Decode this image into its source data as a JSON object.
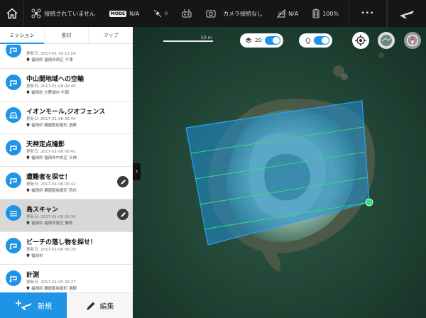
{
  "topbar": {
    "connection_status": "接続されていません",
    "mode_badge": "MODE",
    "mode_value": "N/A",
    "satellite_count": "0",
    "camera_status": "カメラ接続なし",
    "signal_value": "N/A",
    "battery": "100%",
    "more_label": "•••"
  },
  "tabs": [
    {
      "label": "ミッション",
      "active": true
    },
    {
      "label": "素材",
      "active": false
    },
    {
      "label": "マップ",
      "active": false
    }
  ],
  "missions": [
    {
      "title": "",
      "date": "更新日: 2017-01-10 12:04",
      "location": "福岡県 福岡市西区 今津",
      "selected": false,
      "action": false
    },
    {
      "title": "中山間地域への空輸",
      "date": "更新日: 2017-01-08 00:49",
      "location": "福岡県 大野城市 牛頸",
      "selected": false,
      "action": false
    },
    {
      "title": "イオンモール,ジオフェンス",
      "date": "更新日: 2017-01-08 00:44",
      "location": "福岡県 糟屋郡粕屋町 酒殿",
      "selected": false,
      "action": false
    },
    {
      "title": "天神定点撮影",
      "date": "更新日: 2017-01-08 00:43",
      "location": "福岡県 福岡市中央区 天神",
      "selected": false,
      "action": false
    },
    {
      "title": "遭難者を探せ！",
      "date": "更新日: 2017-01-08 00:42",
      "location": "福岡県 糟屋郡粕屋町 若杉",
      "selected": false,
      "action": true
    },
    {
      "title": "島スキャン",
      "date": "更新日: 2017-01-08 00:36",
      "location": "福岡県 福岡市東区 勝馬",
      "selected": true,
      "action": true
    },
    {
      "title": "ビーチの落し物を探せ！",
      "date": "更新日: 2017-01-08 00:29",
      "location": "福岡市",
      "selected": false,
      "action": false
    },
    {
      "title": "計測",
      "date": "更新日: 2017-01-05 20:27",
      "location": "福岡県 糟屋郡粕屋町 酒殿",
      "selected": false,
      "action": false
    }
  ],
  "bottom": {
    "new_label": "新規",
    "edit_label": "編集"
  },
  "map": {
    "view_mode_label": "2D",
    "view_mode_on": true,
    "second_toggle_on": true,
    "scale_label": "50 m"
  },
  "colors": {
    "accent": "#1f93e6",
    "topbar": "#161616",
    "polygon_fill": "#1f8fd6",
    "flight_line": "#33e07a"
  }
}
